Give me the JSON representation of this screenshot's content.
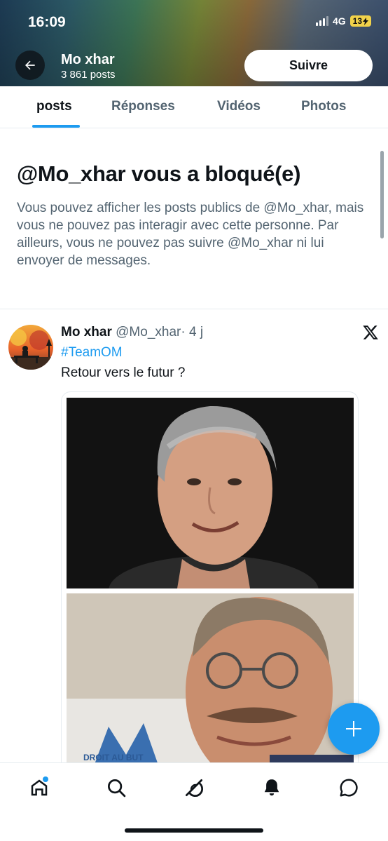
{
  "status_bar": {
    "time": "16:09",
    "network": "4G",
    "battery": "13"
  },
  "header": {
    "name": "Mo xhar",
    "post_count": "3 861 posts",
    "follow_label": "Suivre"
  },
  "tabs": [
    {
      "label": "posts",
      "active": true
    },
    {
      "label": "Réponses",
      "active": false
    },
    {
      "label": "Vidéos",
      "active": false
    },
    {
      "label": "Photos",
      "active": false
    }
  ],
  "blocked": {
    "title": "@Mo_xhar vous a bloqué(e)",
    "text": "Vous pouvez afficher les posts publics de @Mo_xhar, mais vous ne pouvez pas interagir avec cette personne. Par ailleurs, vous ne pouvez pas suivre @Mo_xhar ni lui envoyer de messages."
  },
  "tweet": {
    "name": "Mo xhar",
    "handle": "@Mo_xhar",
    "separator": "·",
    "time": "4 j",
    "hashtag": "#TeamOM",
    "text": "Retour vers le futur ?"
  },
  "bottom_nav": [
    "home-icon",
    "search-icon",
    "grok-icon",
    "notifications-icon",
    "messages-icon"
  ],
  "colors": {
    "accent": "#1d9bf0",
    "text": "#0f1419",
    "secondary": "#536471"
  }
}
